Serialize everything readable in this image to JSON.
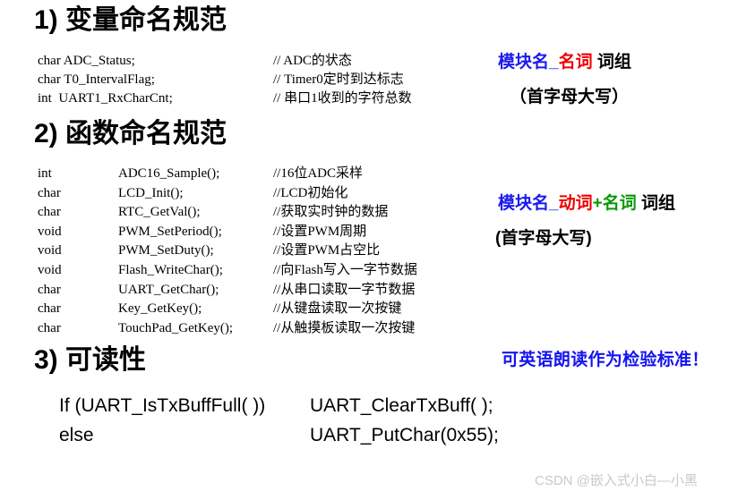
{
  "sections": {
    "variable_naming": {
      "heading": "1) 变量命名规范",
      "declarations": "char ADC_Status;\nchar T0_IntervalFlag;\nint  UART1_RxCharCnt;",
      "comments": "// ADC的状态\n// Timer0定时到达标志\n// 串口1收到的字符总数",
      "annotation": {
        "module": "模块名_",
        "noun": "名词",
        "suffix": " 词组",
        "note": "（首字母大写）"
      }
    },
    "function_naming": {
      "heading": "2) 函数命名规范",
      "rows": [
        {
          "type": "int",
          "name": "ADC16_Sample();",
          "comment": "//16位ADC采样"
        },
        {
          "type": "char",
          "name": "LCD_Init();",
          "comment": "//LCD初始化"
        },
        {
          "type": "char",
          "name": "RTC_GetVal();",
          "comment": "//获取实时钟的数据"
        },
        {
          "type": "void",
          "name": "PWM_SetPeriod();",
          "comment": "//设置PWM周期"
        },
        {
          "type": "void",
          "name": "PWM_SetDuty();",
          "comment": "//设置PWM占空比"
        },
        {
          "type": "void",
          "name": "Flash_WriteChar();",
          "comment": "//向Flash写入一字节数据"
        },
        {
          "type": "char",
          "name": "UART_GetChar();",
          "comment": "//从串口读取一字节数据"
        },
        {
          "type": "char",
          "name": "Key_GetKey();",
          "comment": "//从键盘读取一次按键"
        },
        {
          "type": "char",
          "name": "TouchPad_GetKey();",
          "comment": "//从触摸板读取一次按键"
        }
      ],
      "annotation": {
        "module": "模块名_",
        "verb": "动词",
        "plus": "+",
        "noun": "名词",
        "suffix": " 词组",
        "note": "(首字母大写)"
      }
    },
    "readability": {
      "heading": "3) 可读性",
      "annotation": "可英语朗读作为检验标准！",
      "code_line1_a": "If (UART_IsTxBuffFull( ))",
      "code_line1_b": "UART_ClearTxBuff( );",
      "code_line2_a": "else",
      "code_line2_b": "UART_PutChar(0x55);"
    }
  },
  "watermark": "CSDN @嵌入式小白—小黑",
  "colors": {
    "blue": "#1a1aee",
    "red": "#ee0000",
    "green": "#089808",
    "annotation_blue": "#1414f0",
    "watermark_gray": "#c9c9c9"
  }
}
